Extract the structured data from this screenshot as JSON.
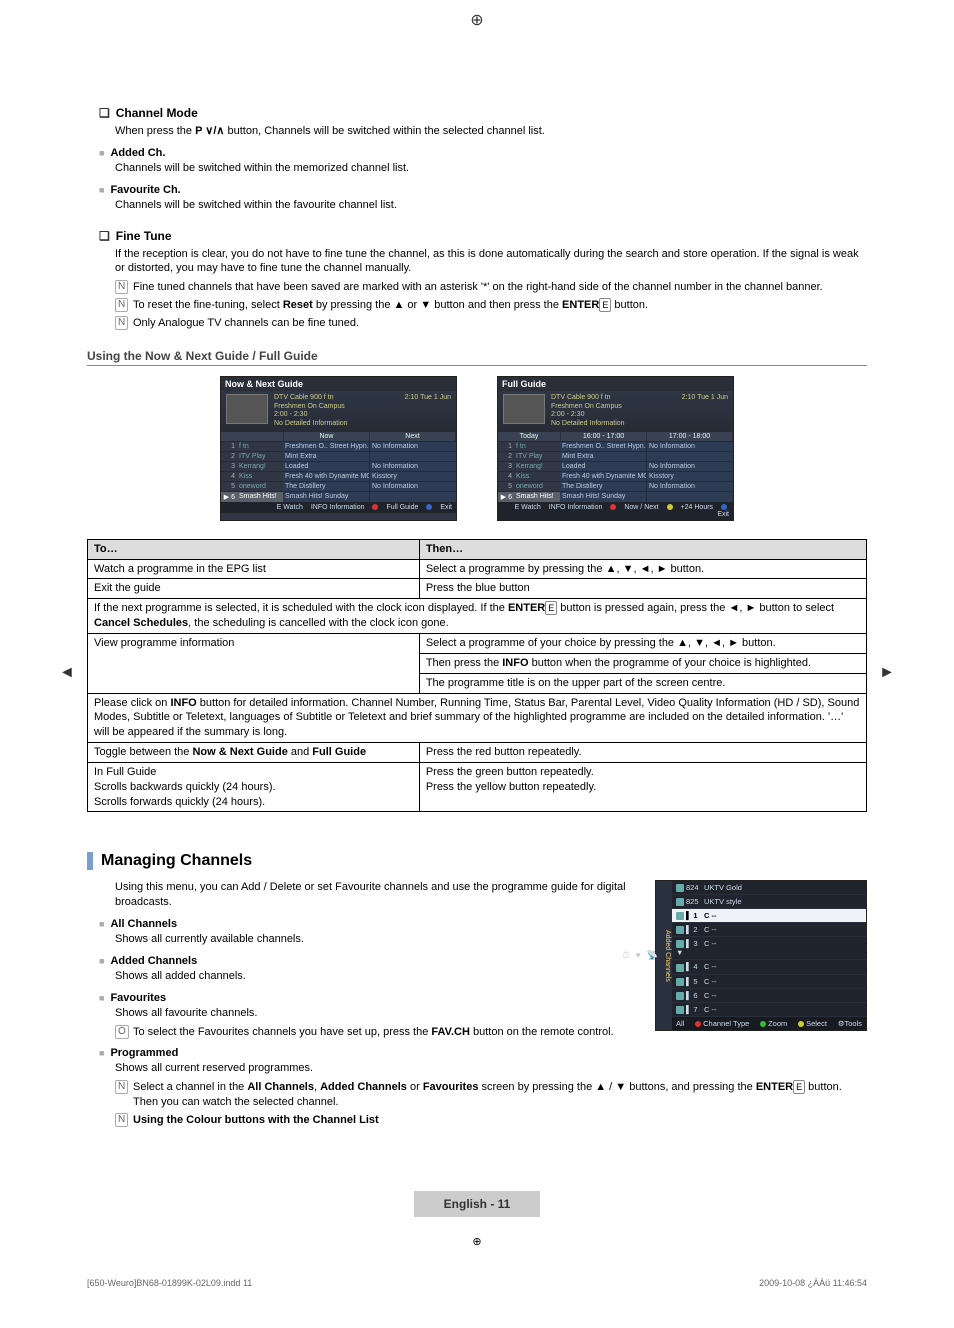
{
  "print_mark_glyph": "⊕",
  "side_arrow_left": "◄",
  "side_arrow_right": "►",
  "channel_mode": {
    "heading": "Channel Mode",
    "line1_pre": "When press the ",
    "line1_mid": "P ∨/∧",
    "line1_post": " button, Channels will be switched within the selected channel list.",
    "added_ch_title": "Added Ch.",
    "added_ch_body": "Channels will be switched within the memorized channel list.",
    "fav_ch_title": "Favourite Ch.",
    "fav_ch_body": "Channels will be switched within the favourite channel list."
  },
  "fine_tune": {
    "heading": "Fine Tune",
    "body": "If the reception is clear, you do not have to fine tune the channel, as this is done automatically during the search and store operation. If the signal is weak or distorted, you may have to fine tune the channel manually.",
    "note1": "Fine tuned channels that have been saved are marked with an asterisk '*' on the right-hand side of the channel number in the channel banner.",
    "note2_pre": "To reset the fine-tuning, select ",
    "note2_bold1": "Reset",
    "note2_mid": " by pressing the ▲ or ▼ button and then press the ",
    "note2_bold2": "ENTER",
    "note2_post": " button.",
    "note3": "Only Analogue TV channels can be fine tuned.",
    "note_icon": "N"
  },
  "guides_heading": "Using the Now & Next Guide / Full Guide",
  "now_next_guide": {
    "title": "Now & Next Guide",
    "meta_line1": "DTV Cable 900 f tn",
    "meta_line2": "Freshmen On Campus",
    "meta_line3": "2:00 - 2:30",
    "meta_line4": "No Detailed Information",
    "time_stamp": "2:10  Tue 1 Jun",
    "col_empty": "",
    "col1": "Now",
    "col2": "Next",
    "rows": [
      {
        "n": "1",
        "ch": "f tn",
        "c1": "Freshmen O.. Street Hypn..",
        "c2": "No Information"
      },
      {
        "n": "2",
        "ch": "ITV Play",
        "c1": "Mint Extra",
        "c2": ""
      },
      {
        "n": "3",
        "ch": "Kerrang!",
        "c1": "Loaded",
        "c2": "No Information"
      },
      {
        "n": "4",
        "ch": "Kiss",
        "c1": "Fresh 40 with Dynamite MC",
        "c2": "Kisstory"
      },
      {
        "n": "5",
        "ch": "oneword",
        "c1": "The Distillery",
        "c2": "No Information"
      },
      {
        "n": "▶ 6",
        "ch": "Smash Hits!",
        "c1": "Smash Hits! Sunday",
        "c2": ""
      }
    ],
    "foot": {
      "watch": "E Watch",
      "info": "INFO Information",
      "red": "Full Guide",
      "exit": "Exit"
    }
  },
  "full_guide": {
    "title": "Full Guide",
    "meta_line1": "DTV Cable 900 f tn",
    "meta_line2": "Freshmen On Campus",
    "meta_line3": "2:00 - 2:30",
    "meta_line4": "No Detailed Information",
    "time_stamp": "2:10  Tue 1 Jun",
    "col0": "Today",
    "col1": "16:00 - 17:00",
    "col2": "17:00 - 18:00",
    "rows": [
      {
        "n": "1",
        "ch": "f tn",
        "c1": "Freshmen O.. Street Hypn..",
        "c2": "No Information"
      },
      {
        "n": "2",
        "ch": "ITV Play",
        "c1": "Mint Extra",
        "c2": ""
      },
      {
        "n": "3",
        "ch": "Kerrang!",
        "c1": "Loaded",
        "c2": "No Information"
      },
      {
        "n": "4",
        "ch": "Kiss",
        "c1": "Fresh 40 with Dynamite MC",
        "c2": "Kisstory"
      },
      {
        "n": "5",
        "ch": "oneword",
        "c1": "The Distillery",
        "c2": "No Information"
      },
      {
        "n": "▶ 6",
        "ch": "Smash Hits!",
        "c1": "Smash Hits! Sunday",
        "c2": ""
      }
    ],
    "foot": {
      "watch": "E Watch",
      "info": "INFO Information",
      "red": "Now / Next",
      "yellow": "+24 Hours",
      "exit": "Exit"
    }
  },
  "table": {
    "h1": "To…",
    "h2": "Then…",
    "r1c1": "Watch a programme in the EPG list",
    "r1c2": "Select a programme by pressing the ▲, ▼, ◄, ► button.",
    "r2c1": "Exit the guide",
    "r2c2": "Press the blue button",
    "r3_pre": "If the next programme is selected, it is scheduled with the clock icon displayed. If the ",
    "r3_bold1": "ENTER",
    "r3_mid": " button is pressed again, press the ◄, ► button to select ",
    "r3_bold2": "Cancel Schedules",
    "r3_post": ", the scheduling is cancelled with the clock icon gone.",
    "r4c1": "View programme information",
    "r4c2a": "Select a programme of your choice by pressing the ▲, ▼, ◄, ► button.",
    "r4c2b_pre": "Then press the ",
    "r4c2b_bold": "INFO",
    "r4c2b_post": " button when the programme of your choice is highlighted.",
    "r4c2c": "The programme title is on the upper part of the screen centre.",
    "r5_pre": "Please click on ",
    "r5_bold": "INFO",
    "r5_post": " button for detailed information. Channel Number, Running Time, Status Bar, Parental Level, Video Quality Information (HD / SD), Sound Modes, Subtitle or Teletext, languages of Subtitle or Teletext and brief summary of the highlighted programme are included on the detailed information. '…' will be appeared if the summary is long.",
    "r6c1_pre": "Toggle between the ",
    "r6c1_b1": "Now & Next Guide",
    "r6c1_mid": " and ",
    "r6c1_b2": "Full Guide",
    "r6c2": "Press the red button repeatedly.",
    "r7c1a": "In Full Guide",
    "r7c1b": "Scrolls backwards quickly (24 hours).",
    "r7c1c": "Scrolls forwards quickly (24 hours).",
    "r7c2a": "",
    "r7c2b": "Press the green button repeatedly.",
    "r7c2c": "Press the yellow button repeatedly."
  },
  "managing": {
    "title": "Managing Channels",
    "intro": "Using this menu, you can Add / Delete or set Favourite channels and use the programme guide for digital broadcasts.",
    "all_ch_t": "All Channels",
    "all_ch_b": "Shows all currently available channels.",
    "added_ch_t": "Added Channels",
    "added_ch_b": "Shows all added channels.",
    "fav_t": "Favourites",
    "fav_b": "Shows all favourite channels.",
    "fav_n_pre": "To select the Favourites channels you have set up, press the ",
    "fav_n_bold": "FAV.CH",
    "fav_n_post": " button on the remote control.",
    "fav_n_icon": "O",
    "prog_t": "Programmed",
    "prog_b": "Shows all current reserved programmes.",
    "prog_n1_pre": "Select a channel in the ",
    "prog_n1_b1": "All Channels",
    "prog_n1_m1": ", ",
    "prog_n1_b2": "Added Channels",
    "prog_n1_m2": " or ",
    "prog_n1_b3": "Favourites",
    "prog_n1_m3": " screen by pressing the ▲ / ▼ buttons, and pressing the ",
    "prog_n1_b4": "ENTER",
    "prog_n1_post": " button. Then you can watch the selected channel.",
    "prog_n2_bold": "Using the Colour buttons with the Channel List",
    "prog_n_icon": "N"
  },
  "channel_box": {
    "tab_label": "Added Channels",
    "all_label": "All",
    "rows": [
      {
        "n": "824",
        "name": "UKTV Gold",
        "sel": false
      },
      {
        "n": "825",
        "name": "UKTV style",
        "sel": false
      },
      {
        "n": "▌ 1",
        "name": "C --",
        "sel": true
      },
      {
        "n": "▌ 2",
        "name": "C --",
        "sel": false
      },
      {
        "n": "▌ 3  ▼",
        "name": "C --",
        "sel": false
      },
      {
        "n": "▌ 4",
        "name": "C --",
        "sel": false
      },
      {
        "n": "▌ 5",
        "name": "C --",
        "sel": false
      },
      {
        "n": "▌ 6",
        "name": "C --",
        "sel": false
      },
      {
        "n": "▌ 7",
        "name": "C --",
        "sel": false
      }
    ],
    "foot": {
      "ch_type": "Channel Type",
      "zoom": "Zoom",
      "select": "Select",
      "tools": "Tools"
    }
  },
  "footer": {
    "page_label": "English - 11",
    "file_left": "[650-Weuro]BN68-01899K-02L09.indd   11",
    "file_right": "2009-10-08   ¿ÀÀü 11:46:54"
  }
}
